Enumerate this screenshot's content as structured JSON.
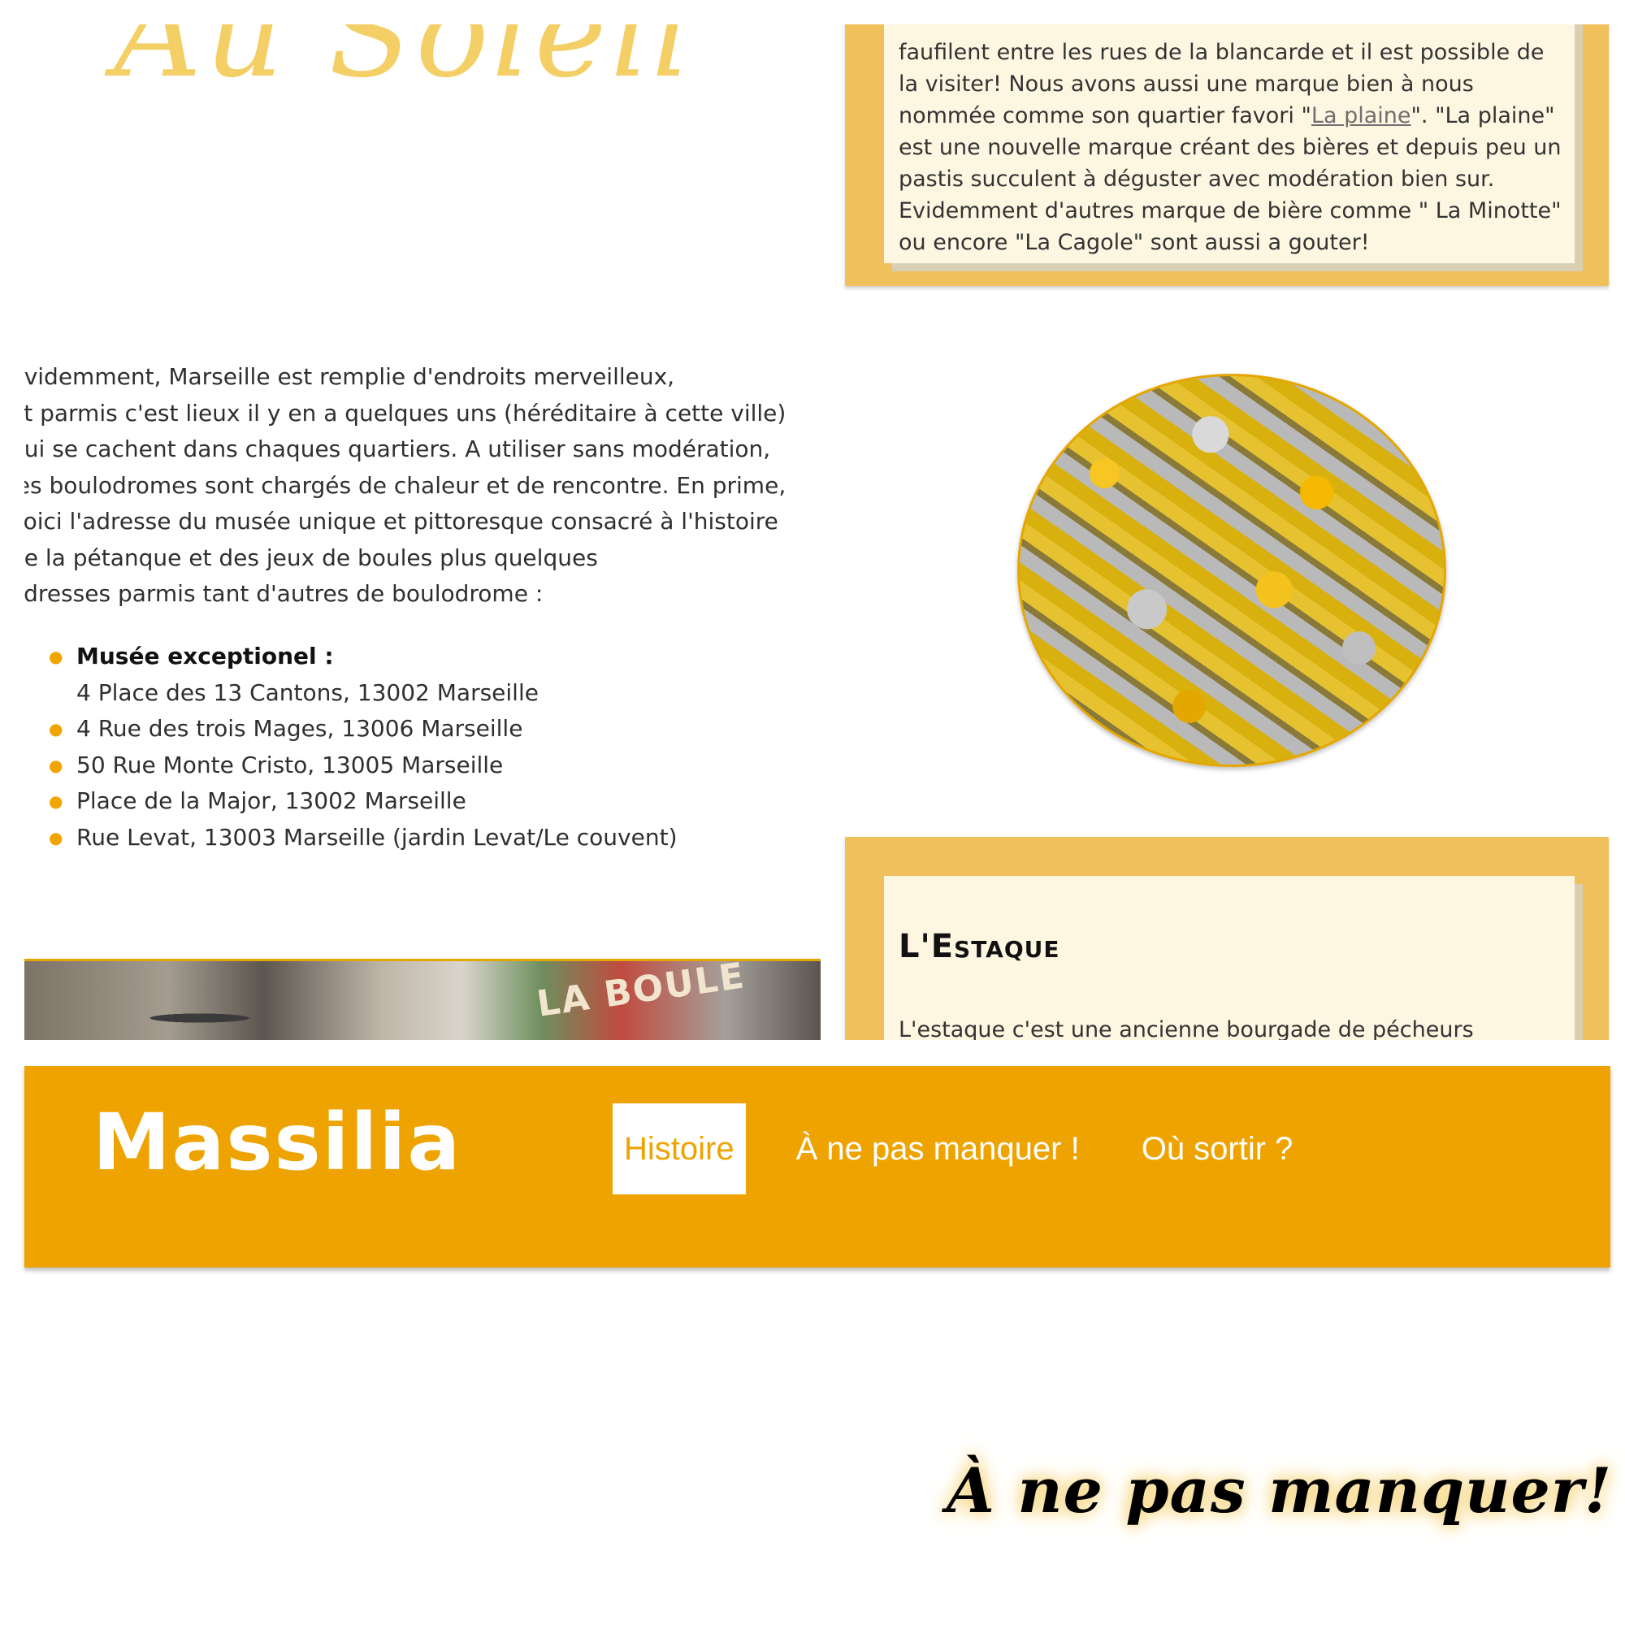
{
  "top_section": {
    "script_heading": "Au Soleil",
    "card_1": {
      "text_before_link": "faufilent entre les rues de la blancarde et il est possible de la visiter! Nous avons aussi une marque bien à nous nommée comme son quartier favori \"",
      "link_text": "La plaine",
      "text_after_link": "\". \"La plaine\" est une nouvelle marque créant des bières et depuis peu un pastis succulent à déguster avec modération bien sur. Evidemment d'autres marque de bière comme \" La Minotte\" ou encore \"La Cagole\" sont aussi a gouter!"
    },
    "intro_lines": [
      "Evidemment, Marseille est remplie d'endroits merveilleux,",
      "et parmis c'est lieux il y en a quelques uns (héréditaire à cette ville)",
      "qui se cachent dans chaques quartiers. A utiliser sans modération,",
      "les boulodromes sont chargés de chaleur et de rencontre. En prime,",
      "voici l'adresse du musée unique et pittoresque consacré à l'histoire",
      "de la pétanque et des jeux de boules plus quelques",
      "adresses parmis tant d'autres de boulodrome :"
    ],
    "addresses": [
      {
        "bold": "Musée exceptionel :",
        "text": "4 Place des 13 Cantons, 13002 Marseille"
      },
      {
        "bold": "",
        "text": "4 Rue des trois Mages, 13006 Marseille"
      },
      {
        "bold": "",
        "text": "50 Rue Monte Cristo, 13005 Marseille"
      },
      {
        "bold": "",
        "text": "Place de la Major, 13002 Marseille"
      },
      {
        "bold": "",
        "text": "Rue Levat, 13003 Marseille (jardin Levat/Le couvent)"
      }
    ],
    "beer_image_icon": "beer-caps-photo",
    "photo_strip_label": "LA BOULE",
    "card_2": {
      "title": "L'Estaque",
      "text": "L'estaque c'est une ancienne bourgade de pécheurs rattachée à Marseille. Piéton rendez-vous à la Joliette pour prendre le bus"
    }
  },
  "navbar": {
    "brand": "Massilia",
    "items": [
      {
        "label": "Histoire",
        "active": true
      },
      {
        "label": "À ne pas manquer !",
        "active": false
      },
      {
        "label": "Où sortir ?",
        "active": false
      }
    ]
  },
  "bottom_section": {
    "title": "À ne pas manquer!"
  },
  "colors": {
    "nav_background": "#eea300",
    "card_border": "#f0c05c",
    "card_background": "#fdf6e1",
    "bullet": "#f0a500",
    "script_heading": "#f4cf66"
  }
}
